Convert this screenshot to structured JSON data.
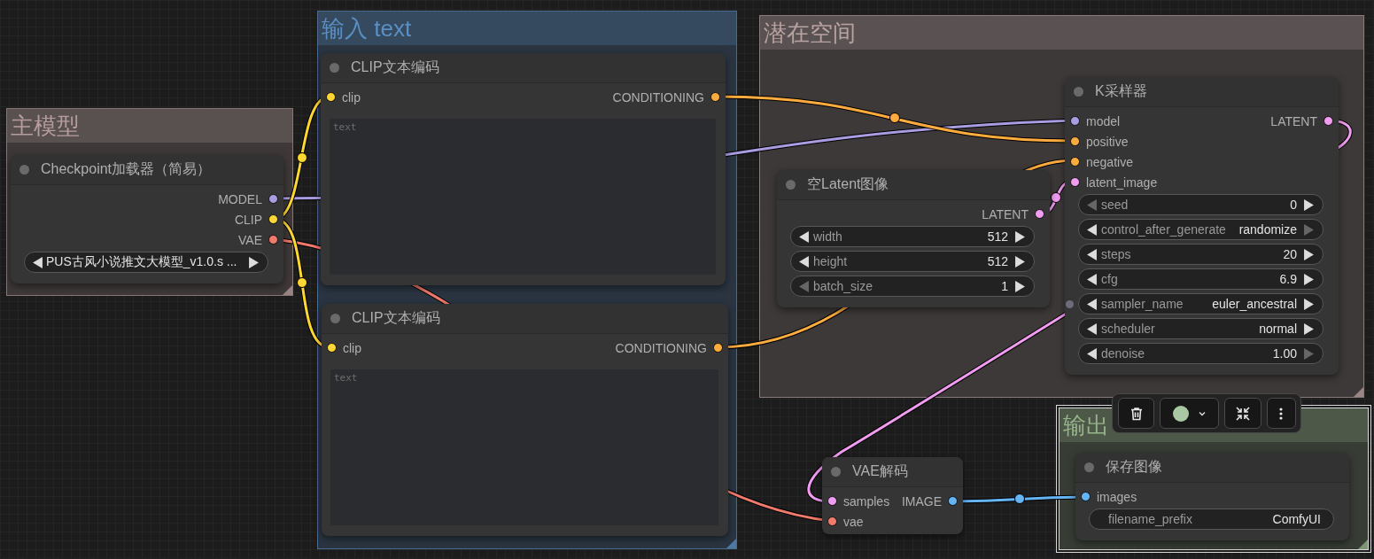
{
  "groups": [
    {
      "title": "主模型",
      "color": "#b59d9d",
      "selected": false
    },
    {
      "title": "输入 text",
      "color": "#5b8ec2",
      "selected": false
    },
    {
      "title": "潜在空间",
      "color": "#b8a2a2",
      "selected": false
    },
    {
      "title": "输出",
      "color": "#96b38b",
      "selected": true
    }
  ],
  "nodes": [
    {
      "title": "Checkpoint加载器（简易）",
      "outputs": [
        {
          "name": "MODEL",
          "color": "#a99ce0"
        },
        {
          "name": "CLIP",
          "color": "#ffd633"
        },
        {
          "name": "VAE",
          "color": "#f07a6c"
        }
      ],
      "widgets": [
        {
          "kind": "combo",
          "value": "PUS古风小说推文大模型_v1.0.s ...",
          "prev_disabled": false,
          "next_disabled": false
        }
      ]
    },
    {
      "title": "CLIP文本编码",
      "inputs": [
        {
          "name": "clip",
          "color": "#ffd633"
        }
      ],
      "outputs": [
        {
          "name": "CONDITIONING",
          "color": "#ffab3d"
        }
      ],
      "widgets": [
        {
          "kind": "textarea",
          "placeholder": "text"
        }
      ]
    },
    {
      "title": "CLIP文本编码",
      "inputs": [
        {
          "name": "clip",
          "color": "#ffd633"
        }
      ],
      "outputs": [
        {
          "name": "CONDITIONING",
          "color": "#ffab3d"
        }
      ],
      "widgets": [
        {
          "kind": "textarea",
          "placeholder": "text"
        }
      ]
    },
    {
      "title": "空Latent图像",
      "outputs": [
        {
          "name": "LATENT",
          "color": "#f09cf0"
        }
      ],
      "widgets": [
        {
          "kind": "number",
          "label": "width",
          "value": "512",
          "prev_disabled": false,
          "next_disabled": false
        },
        {
          "kind": "number",
          "label": "height",
          "value": "512",
          "prev_disabled": false,
          "next_disabled": false
        },
        {
          "kind": "number",
          "label": "batch_size",
          "value": "1",
          "prev_disabled": true,
          "next_disabled": false
        }
      ]
    },
    {
      "title": "K采样器",
      "inputs": [
        {
          "name": "model",
          "color": "#a99ce0"
        },
        {
          "name": "positive",
          "color": "#ffab3d"
        },
        {
          "name": "negative",
          "color": "#ffab3d"
        },
        {
          "name": "latent_image",
          "color": "#f09cf0"
        }
      ],
      "outputs": [
        {
          "name": "LATENT",
          "color": "#f09cf0"
        }
      ],
      "widgets": [
        {
          "kind": "number",
          "label": "seed",
          "value": "0",
          "prev_disabled": true,
          "next_disabled": false
        },
        {
          "kind": "combo",
          "label": "control_after_generate",
          "value": "randomize",
          "prev_disabled": false,
          "next_disabled": true
        },
        {
          "kind": "number",
          "label": "steps",
          "value": "20",
          "prev_disabled": false,
          "next_disabled": false
        },
        {
          "kind": "number",
          "label": "cfg",
          "value": "6.9",
          "prev_disabled": false,
          "next_disabled": false
        },
        {
          "kind": "combo",
          "label": "sampler_name",
          "value": "euler_ancestral",
          "prev_disabled": false,
          "next_disabled": false,
          "socket": true
        },
        {
          "kind": "combo",
          "label": "scheduler",
          "value": "normal",
          "prev_disabled": false,
          "next_disabled": false
        },
        {
          "kind": "number",
          "label": "denoise",
          "value": "1.00",
          "prev_disabled": false,
          "next_disabled": true
        }
      ]
    },
    {
      "title": "VAE解码",
      "inputs": [
        {
          "name": "samples",
          "color": "#f09cf0"
        },
        {
          "name": "vae",
          "color": "#f07a6c"
        }
      ],
      "outputs": [
        {
          "name": "IMAGE",
          "color": "#64b5f6"
        }
      ]
    },
    {
      "title": "保存图像",
      "inputs": [
        {
          "name": "images",
          "color": "#64b5f6"
        }
      ],
      "widgets": [
        {
          "kind": "text",
          "label": "filename_prefix",
          "value": "ComfyUI"
        }
      ]
    }
  ],
  "toolbar": {
    "color": "#a9c7a2"
  }
}
